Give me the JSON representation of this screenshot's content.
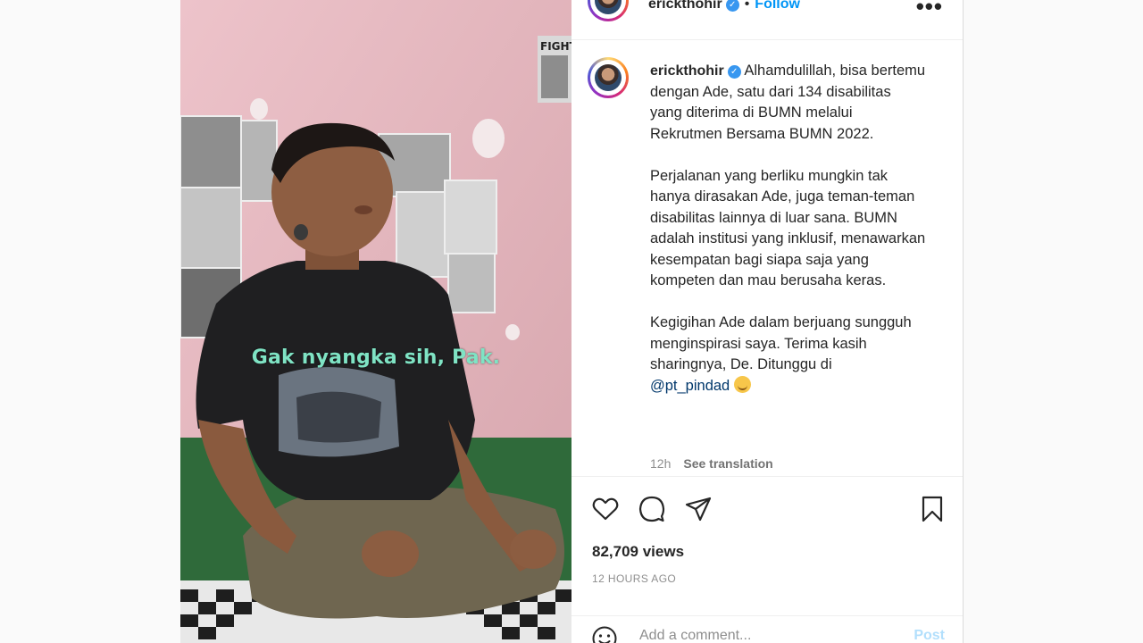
{
  "media": {
    "subtitle": "Gak nyangka sih, Pak.",
    "poster_text": "FIGHT"
  },
  "post": {
    "username": "erickthohir",
    "verified_icon": "verified-badge-icon",
    "follow_label": "Follow",
    "more_icon": "more-options-icon",
    "caption_username": "erickthohir",
    "caption_paragraphs": [
      "Alhamdulillah, bisa bertemu dengan Ade, satu dari 134 disabilitas yang diterima di BUMN melalui Rekrutmen Bersama BUMN 2022.",
      "Perjalanan yang berliku mungkin tak hanya dirasakan Ade, juga teman-teman disabilitas lainnya di luar sana. BUMN adalah institusi yang inklusif, menawarkan kesempatan bagi siapa saja yang kompeten dan mau berusaha keras.",
      "Kegigihan Ade dalam berjuang sungguh menginspirasi saya. Terima kasih sharingnya, De. Ditunggu di"
    ],
    "mention": "@pt_pindad",
    "mention_emoji": "smiling-face-emoji",
    "time": "12h",
    "see_translation": "See translation",
    "views": "82,709 views",
    "posted_ago": "12 HOURS AGO",
    "comment_placeholder": "Add a comment...",
    "post_label": "Post"
  },
  "colors": {
    "link": "#0095f6",
    "verified": "#3897f0",
    "subtitle": "#7fe3c4",
    "post_disabled": "#b2dffc"
  }
}
